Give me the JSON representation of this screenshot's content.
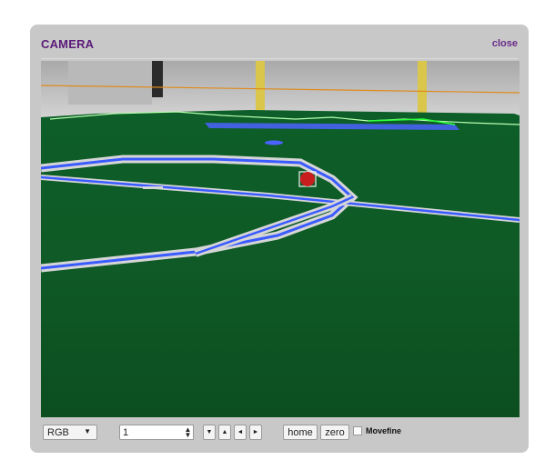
{
  "panel": {
    "title": "CAMERA",
    "close_label": "close"
  },
  "controls": {
    "mode_selected": "RGB",
    "step_value": "1",
    "down_glyph": "▼",
    "up_glyph": "▲",
    "left_glyph": "◄",
    "right_glyph": "►",
    "home_label": "home",
    "zero_label": "zero",
    "movefine_label": "Movefine",
    "movefine_checked": false
  },
  "icons": {
    "select": "chevron-down-icon",
    "spinner": "spinner-arrows-icon"
  },
  "colors": {
    "title": "#5b1a78",
    "panel": "#c8c8c8",
    "field": "#0f5a26",
    "field_line_overlay": "#3a5bff",
    "horizon_line": "#e08a1a",
    "boundary_line": "#b8ffb0",
    "ball": "#c81e1e"
  }
}
